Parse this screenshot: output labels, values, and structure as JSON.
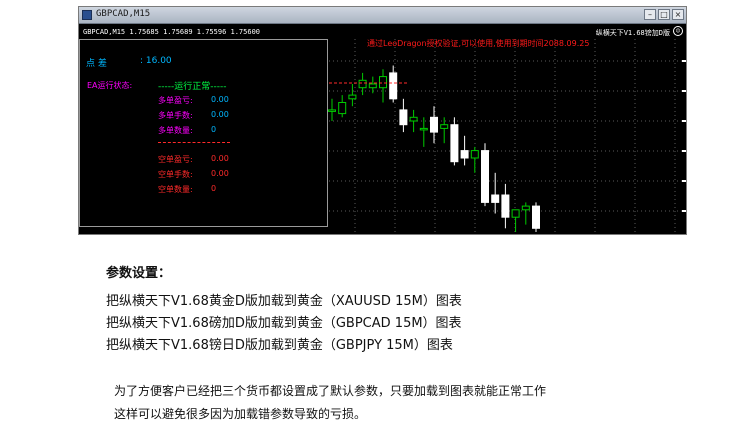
{
  "window": {
    "title": "GBPCAD,M15",
    "symbol_info": "GBPCAD,M15  1.75685 1.75689 1.75596 1.75600",
    "ea_label": "纵横天下V1.68镑加D版",
    "status_icon": "smiley-icon"
  },
  "panel": {
    "spread_label": "点        差",
    "spread_value": ": 16.00",
    "status_label": "EA运行状态:",
    "status_value": "-----运行正常-----",
    "buy_profit_label": "多单盈亏:",
    "buy_profit_value": "0.00",
    "buy_lots_label": "多单手数:",
    "buy_lots_value": "0.00",
    "buy_count_label": "多单数量:",
    "buy_count_value": "0",
    "sell_profit_label": "空单盈亏:",
    "sell_profit_value": "0.00",
    "sell_lots_label": "空单手数:",
    "sell_lots_value": "0.00",
    "sell_count_label": "空单数量:",
    "sell_count_value": "0"
  },
  "watermark": "通过LeoDragon授权验证,可以使用,使用到期时间2088.09.25",
  "colors": {
    "bull": "#00cc00",
    "bear": "#ffffff",
    "grid": "#5a5a5a",
    "panel_cyan": "#00b7ff",
    "panel_magenta": "#ff00ff",
    "panel_red": "#ff2a2a"
  },
  "chart_data": {
    "type": "candlestick",
    "candles": [
      {
        "o": 0.66,
        "h": 0.72,
        "l": 0.6,
        "c": 0.66
      },
      {
        "o": 0.64,
        "h": 0.74,
        "l": 0.62,
        "c": 0.7
      },
      {
        "o": 0.72,
        "h": 0.8,
        "l": 0.68,
        "c": 0.74
      },
      {
        "o": 0.78,
        "h": 0.86,
        "l": 0.74,
        "c": 0.82
      },
      {
        "o": 0.78,
        "h": 0.84,
        "l": 0.75,
        "c": 0.8
      },
      {
        "o": 0.78,
        "h": 0.88,
        "l": 0.7,
        "c": 0.84
      },
      {
        "o": 0.86,
        "h": 0.9,
        "l": 0.7,
        "c": 0.72
      },
      {
        "o": 0.66,
        "h": 0.72,
        "l": 0.54,
        "c": 0.58
      },
      {
        "o": 0.6,
        "h": 0.66,
        "l": 0.54,
        "c": 0.62
      },
      {
        "o": 0.56,
        "h": 0.62,
        "l": 0.46,
        "c": 0.56
      },
      {
        "o": 0.62,
        "h": 0.68,
        "l": 0.48,
        "c": 0.54
      },
      {
        "o": 0.56,
        "h": 0.62,
        "l": 0.48,
        "c": 0.58
      },
      {
        "o": 0.58,
        "h": 0.62,
        "l": 0.36,
        "c": 0.38
      },
      {
        "o": 0.44,
        "h": 0.52,
        "l": 0.36,
        "c": 0.4
      },
      {
        "o": 0.4,
        "h": 0.46,
        "l": 0.32,
        "c": 0.44
      },
      {
        "o": 0.44,
        "h": 0.48,
        "l": 0.14,
        "c": 0.16
      },
      {
        "o": 0.2,
        "h": 0.32,
        "l": 0.1,
        "c": 0.16
      },
      {
        "o": 0.2,
        "h": 0.26,
        "l": 0.02,
        "c": 0.08
      },
      {
        "o": 0.08,
        "h": 0.12,
        "l": 0.0,
        "c": 0.12
      },
      {
        "o": 0.12,
        "h": 0.16,
        "l": 0.04,
        "c": 0.14
      },
      {
        "o": 0.14,
        "h": 0.16,
        "l": 0.0,
        "c": 0.02
      }
    ]
  },
  "section": {
    "header": "参数设置：",
    "lines": [
      "把纵横天下V1.68黄金D版加载到黄金（XAUUSD 15M）图表",
      "把纵横天下V1.68磅加D版加载到黄金（GBPCAD 15M）图表",
      "把纵横天下V1.68镑日D版加载到黄金（GBPJPY 15M）图表"
    ],
    "notes": [
      "为了方便客户已经把三个货币都设置成了默认参数，只要加载到图表就能正常工作",
      "这样可以避免很多因为加载错参数导致的亏损。"
    ]
  }
}
